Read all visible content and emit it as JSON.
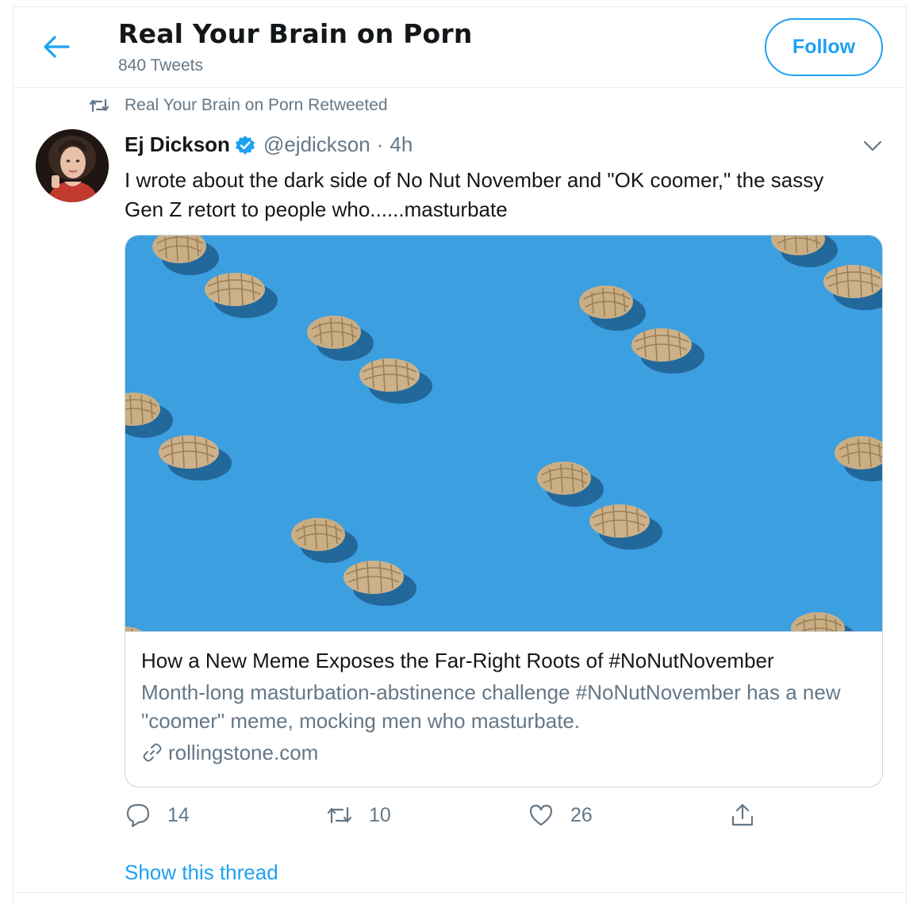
{
  "header": {
    "title": "Real Your Brain on Porn",
    "subtitle": "840 Tweets",
    "follow_label": "Follow",
    "back_icon": "arrow-left-icon"
  },
  "retweet_context": {
    "label": "Real Your Brain on Porn Retweeted",
    "icon": "retweet-icon"
  },
  "tweet": {
    "author_name": "Ej Dickson",
    "verified": true,
    "handle": "@ejdickson",
    "separator": "·",
    "time": "4h",
    "text": "I wrote about the dark side of No Nut November and \"OK coomer,\" the sassy Gen Z retort to people who......masturbate",
    "card": {
      "title": "How a New Meme Exposes the Far-Right Roots of #NoNutNovember",
      "description": "Month-long masturbation-abstinence challenge #NoNutNovember has a new \"coomer\" meme, mocking men who masturbate.",
      "domain": "rollingstone.com",
      "image_background": "#3c9fe0"
    },
    "actions": {
      "reply_count": "14",
      "retweet_count": "10",
      "like_count": "26"
    },
    "show_thread_label": "Show this thread"
  },
  "colors": {
    "accent": "#1da1f2",
    "text_primary": "#14171a",
    "text_secondary": "#657786",
    "border": "#e6ecf0"
  }
}
